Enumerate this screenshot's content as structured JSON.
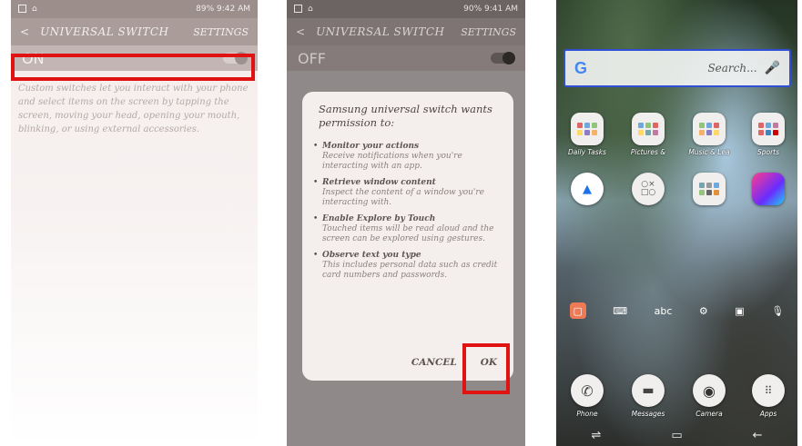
{
  "screen1": {
    "status": {
      "left_icons": [
        "notification-icon",
        "lock-icon"
      ],
      "right_text": "89% 9:42 AM"
    },
    "appbar": {
      "back": "<",
      "title": "UNIVERSAL SWITCH",
      "settings": "SETTINGS"
    },
    "switch": {
      "label": "ON",
      "state": "on"
    },
    "description": "Custom switches let you interact with your phone and select items on the screen by tapping the screen, moving your head, opening your mouth, blinking, or using external accessories."
  },
  "screen2": {
    "status": {
      "right_text": "90% 9:41 AM"
    },
    "appbar": {
      "back": "<",
      "title": "UNIVERSAL SWITCH",
      "settings": "SETTINGS"
    },
    "switch": {
      "label": "OFF",
      "state": "off"
    },
    "dialog": {
      "title": "Samsung universal switch wants permission to:",
      "permissions": [
        {
          "title": "Monitor your actions",
          "desc": "Receive notifications when you're interacting with an app."
        },
        {
          "title": "Retrieve window content",
          "desc": "Inspect the content of a window you're interacting with."
        },
        {
          "title": "Enable Explore by Touch",
          "desc": "Touched items will be read aloud and the screen can be explored using gestures."
        },
        {
          "title": "Observe text you type",
          "desc": "This includes personal data such as credit card numbers and passwords."
        }
      ],
      "cancel": "CANCEL",
      "ok": "OK"
    }
  },
  "screen3": {
    "search": {
      "logo": "G",
      "placeholder": "Search..."
    },
    "apps_row1": [
      "Daily Tasks",
      "Pictures &",
      "Music & Lea",
      "Sports"
    ],
    "apps_row2": [
      "",
      "",
      "",
      ""
    ],
    "dock": [
      "Phone",
      "Messages",
      "Camera",
      "Apps"
    ],
    "keyboard_row": [
      "",
      "",
      "abc",
      "",
      "",
      ""
    ]
  },
  "colors": {
    "highlight": "#e11212",
    "search_border": "#2f4fd6"
  }
}
